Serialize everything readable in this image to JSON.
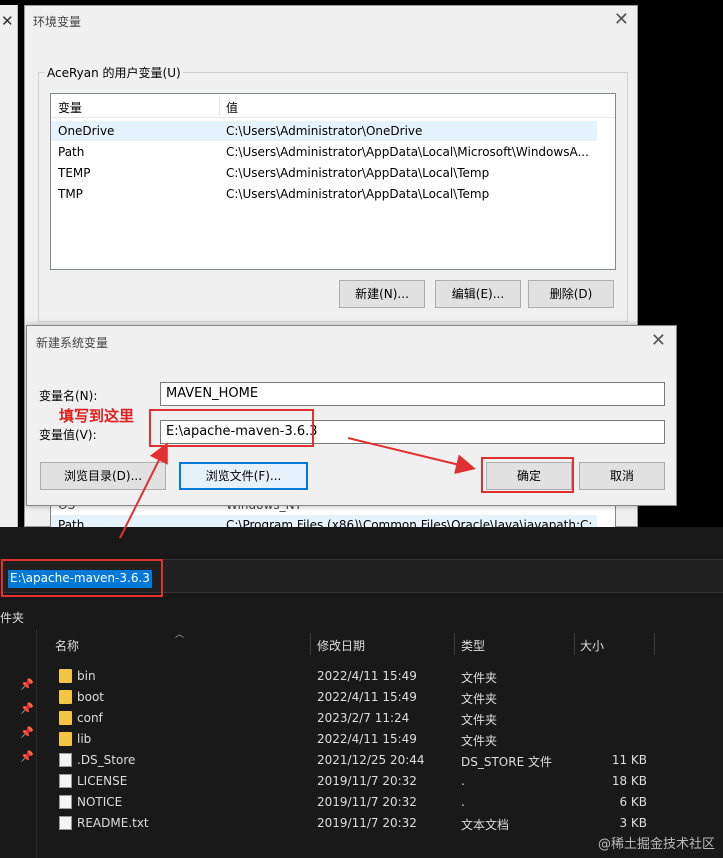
{
  "env_dialog": {
    "title": "环境变量",
    "user_group_label": "AceRyan 的用户变量(U)",
    "columns": [
      "变量",
      "值"
    ],
    "rows": [
      {
        "name": "OneDrive",
        "value": "C:\\Users\\Administrator\\OneDrive"
      },
      {
        "name": "Path",
        "value": "C:\\Users\\Administrator\\AppData\\Local\\Microsoft\\WindowsA..."
      },
      {
        "name": "TEMP",
        "value": "C:\\Users\\Administrator\\AppData\\Local\\Temp"
      },
      {
        "name": "TMP",
        "value": "C:\\Users\\Administrator\\AppData\\Local\\Temp"
      }
    ],
    "buttons": {
      "new": "新建(N)...",
      "edit": "编辑(E)...",
      "delete": "删除(D)"
    },
    "system_rows_partial": [
      {
        "name": "OS",
        "value": "Windows_NT"
      },
      {
        "name": "Path",
        "value": "C:\\Program Files (x86)\\Common Files\\Oracle\\Java\\javapath;C:..."
      }
    ]
  },
  "new_dialog": {
    "title": "新建系统变量",
    "name_label": "变量名(N):",
    "value_label": "变量值(V):",
    "name_value": "MAVEN_HOME",
    "value_value": "E:\\apache-maven-3.6.3",
    "hint": "填写到这里",
    "buttons": {
      "browse_dir": "浏览目录(D)...",
      "browse_file": "浏览文件(F)...",
      "ok": "确定",
      "cancel": "取消"
    }
  },
  "explorer": {
    "address": "E:\\apache-maven-3.6.3",
    "crumb": "件夹",
    "columns": {
      "name": "名称",
      "date": "修改日期",
      "type": "类型",
      "size": "大小"
    },
    "files": [
      {
        "name": "bin",
        "date": "2022/4/11 15:49",
        "type": "文件夹",
        "size": "",
        "kind": "folder"
      },
      {
        "name": "boot",
        "date": "2022/4/11 15:49",
        "type": "文件夹",
        "size": "",
        "kind": "folder"
      },
      {
        "name": "conf",
        "date": "2023/2/7 11:24",
        "type": "文件夹",
        "size": "",
        "kind": "folder"
      },
      {
        "name": "lib",
        "date": "2022/4/11 15:49",
        "type": "文件夹",
        "size": "",
        "kind": "folder"
      },
      {
        "name": ".DS_Store",
        "date": "2021/12/25 20:44",
        "type": "DS_STORE 文件",
        "size": "11 KB",
        "kind": "file"
      },
      {
        "name": "LICENSE",
        "date": "2019/11/7 20:32",
        "type": ".",
        "size": "18 KB",
        "kind": "file"
      },
      {
        "name": "NOTICE",
        "date": "2019/11/7 20:32",
        "type": ".",
        "size": "6 KB",
        "kind": "file"
      },
      {
        "name": "README.txt",
        "date": "2019/11/7 20:32",
        "type": "文本文档",
        "size": "3 KB",
        "kind": "file"
      }
    ],
    "watermark": "@稀土掘金技术社区"
  },
  "colors": {
    "annotation_red": "#e03030",
    "selection_blue": "#0078d7"
  }
}
